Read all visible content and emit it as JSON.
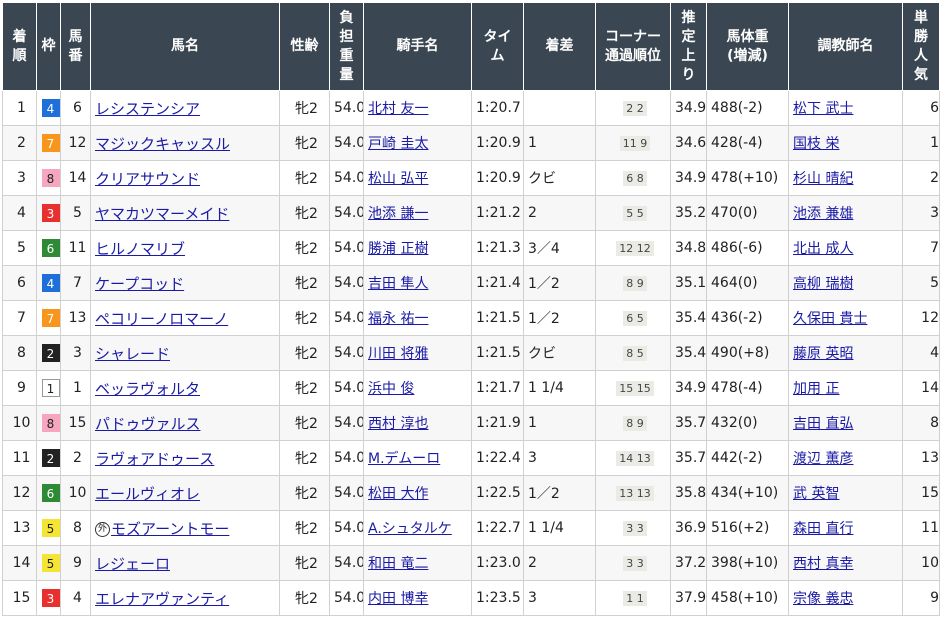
{
  "headers": {
    "rank": [
      "着",
      "順"
    ],
    "waku": [
      "枠"
    ],
    "umaban": [
      "馬",
      "番"
    ],
    "horse": [
      "馬名"
    ],
    "sexage": [
      "性齢"
    ],
    "weight": [
      "負",
      "担",
      "重",
      "量"
    ],
    "jockey": [
      "騎手名"
    ],
    "time": [
      "タイ",
      "ム"
    ],
    "margin": [
      "着差"
    ],
    "corner": [
      "コーナー",
      "通過順位"
    ],
    "last3f": [
      "推",
      "定",
      "上",
      "り"
    ],
    "bodyweight": [
      "馬体重",
      "(増減)"
    ],
    "trainer": [
      "調教師名"
    ],
    "popularity": [
      "単",
      "勝",
      "人",
      "気"
    ]
  },
  "waku_colors": {
    "1": {
      "bg": "#ffffff",
      "fg": "#222222",
      "border": "#999999"
    },
    "2": {
      "bg": "#222222",
      "fg": "#ffffff",
      "border": "#222222"
    },
    "3": {
      "bg": "#e8302f",
      "fg": "#ffffff",
      "border": "#e8302f"
    },
    "4": {
      "bg": "#1f6fdb",
      "fg": "#ffffff",
      "border": "#1f6fdb"
    },
    "5": {
      "bg": "#f4e534",
      "fg": "#222222",
      "border": "#f4e534"
    },
    "6": {
      "bg": "#2f8a35",
      "fg": "#ffffff",
      "border": "#2f8a35"
    },
    "7": {
      "bg": "#f7951d",
      "fg": "#ffffff",
      "border": "#f7951d"
    },
    "8": {
      "bg": "#f6a7bf",
      "fg": "#222222",
      "border": "#f6a7bf"
    }
  },
  "rows": [
    {
      "rank": "1",
      "waku": "4",
      "umaban": "6",
      "horse": "レシステンシア",
      "marker": "",
      "sexage": "牝2",
      "weight": "54.0",
      "jockey": "北村 友一",
      "time": "1:20.7",
      "margin": "",
      "corner": "2 2",
      "last3f": "34.9",
      "bodyweight": "488(-2)",
      "trainer": "松下 武士",
      "popularity": "6"
    },
    {
      "rank": "2",
      "waku": "7",
      "umaban": "12",
      "horse": "マジックキャッスル",
      "marker": "",
      "sexage": "牝2",
      "weight": "54.0",
      "jockey": "戸崎 圭太",
      "time": "1:20.9",
      "margin": "1",
      "corner": "11 9",
      "last3f": "34.6",
      "bodyweight": "428(-4)",
      "trainer": "国枝 栄",
      "popularity": "1"
    },
    {
      "rank": "3",
      "waku": "8",
      "umaban": "14",
      "horse": "クリアサウンド",
      "marker": "",
      "sexage": "牝2",
      "weight": "54.0",
      "jockey": "松山 弘平",
      "time": "1:20.9",
      "margin": "クビ",
      "corner": "6 8",
      "last3f": "34.9",
      "bodyweight": "478(+10)",
      "trainer": "杉山 晴紀",
      "popularity": "2"
    },
    {
      "rank": "4",
      "waku": "3",
      "umaban": "5",
      "horse": "ヤマカツマーメイド",
      "marker": "",
      "sexage": "牝2",
      "weight": "54.0",
      "jockey": "池添 謙一",
      "time": "1:21.2",
      "margin": "2",
      "corner": "5 5",
      "last3f": "35.2",
      "bodyweight": "470(0)",
      "trainer": "池添 兼雄",
      "popularity": "3"
    },
    {
      "rank": "5",
      "waku": "6",
      "umaban": "11",
      "horse": "ヒルノマリブ",
      "marker": "",
      "sexage": "牝2",
      "weight": "54.0",
      "jockey": "勝浦 正樹",
      "time": "1:21.3",
      "margin": "3／4",
      "corner": "12 12",
      "last3f": "34.8",
      "bodyweight": "486(-6)",
      "trainer": "北出 成人",
      "popularity": "7"
    },
    {
      "rank": "6",
      "waku": "4",
      "umaban": "7",
      "horse": "ケープコッド",
      "marker": "",
      "sexage": "牝2",
      "weight": "54.0",
      "jockey": "吉田 隼人",
      "time": "1:21.4",
      "margin": "1／2",
      "corner": "8 9",
      "last3f": "35.1",
      "bodyweight": "464(0)",
      "trainer": "高柳 瑞樹",
      "popularity": "5"
    },
    {
      "rank": "7",
      "waku": "7",
      "umaban": "13",
      "horse": "ペコリーノロマーノ",
      "marker": "",
      "sexage": "牝2",
      "weight": "54.0",
      "jockey": "福永 祐一",
      "time": "1:21.5",
      "margin": "1／2",
      "corner": "6 5",
      "last3f": "35.4",
      "bodyweight": "436(-2)",
      "trainer": "久保田 貴士",
      "popularity": "12"
    },
    {
      "rank": "8",
      "waku": "2",
      "umaban": "3",
      "horse": "シャレード",
      "marker": "",
      "sexage": "牝2",
      "weight": "54.0",
      "jockey": "川田 将雅",
      "time": "1:21.5",
      "margin": "クビ",
      "corner": "8 5",
      "last3f": "35.4",
      "bodyweight": "490(+8)",
      "trainer": "藤原 英昭",
      "popularity": "4"
    },
    {
      "rank": "9",
      "waku": "1",
      "umaban": "1",
      "horse": "ベッラヴォルタ",
      "marker": "",
      "sexage": "牝2",
      "weight": "54.0",
      "jockey": "浜中 俊",
      "time": "1:21.7",
      "margin": "1 1/4",
      "corner": "15 15",
      "last3f": "34.9",
      "bodyweight": "478(-4)",
      "trainer": "加用 正",
      "popularity": "14"
    },
    {
      "rank": "10",
      "waku": "8",
      "umaban": "15",
      "horse": "パドゥヴァルス",
      "marker": "",
      "sexage": "牝2",
      "weight": "54.0",
      "jockey": "西村 淳也",
      "time": "1:21.9",
      "margin": "1",
      "corner": "8 9",
      "last3f": "35.7",
      "bodyweight": "432(0)",
      "trainer": "吉田 直弘",
      "popularity": "8"
    },
    {
      "rank": "11",
      "waku": "2",
      "umaban": "2",
      "horse": "ラヴォアドゥース",
      "marker": "",
      "sexage": "牝2",
      "weight": "54.0",
      "jockey": "M.デムーロ",
      "time": "1:22.4",
      "margin": "3",
      "corner": "14 13",
      "last3f": "35.7",
      "bodyweight": "442(-2)",
      "trainer": "渡辺 薫彦",
      "popularity": "13"
    },
    {
      "rank": "12",
      "waku": "6",
      "umaban": "10",
      "horse": "エールヴィオレ",
      "marker": "",
      "sexage": "牝2",
      "weight": "54.0",
      "jockey": "松田 大作",
      "time": "1:22.5",
      "margin": "1／2",
      "corner": "13 13",
      "last3f": "35.8",
      "bodyweight": "434(+10)",
      "trainer": "武 英智",
      "popularity": "15"
    },
    {
      "rank": "13",
      "waku": "5",
      "umaban": "8",
      "horse": "モズアーントモー",
      "marker": "外",
      "sexage": "牝2",
      "weight": "54.0",
      "jockey": "A.シュタルケ",
      "time": "1:22.7",
      "margin": "1 1/4",
      "corner": "3 3",
      "last3f": "36.9",
      "bodyweight": "516(+2)",
      "trainer": "森田 直行",
      "popularity": "11"
    },
    {
      "rank": "14",
      "waku": "5",
      "umaban": "9",
      "horse": "レジェーロ",
      "marker": "",
      "sexage": "牝2",
      "weight": "54.0",
      "jockey": "和田 竜二",
      "time": "1:23.0",
      "margin": "2",
      "corner": "3 3",
      "last3f": "37.2",
      "bodyweight": "398(+10)",
      "trainer": "西村 真幸",
      "popularity": "10"
    },
    {
      "rank": "15",
      "waku": "3",
      "umaban": "4",
      "horse": "エレナアヴァンティ",
      "marker": "",
      "sexage": "牝2",
      "weight": "54.0",
      "jockey": "内田 博幸",
      "time": "1:23.5",
      "margin": "3",
      "corner": "1 1",
      "last3f": "37.9",
      "bodyweight": "458(+10)",
      "trainer": "宗像 義忠",
      "popularity": "9"
    }
  ]
}
